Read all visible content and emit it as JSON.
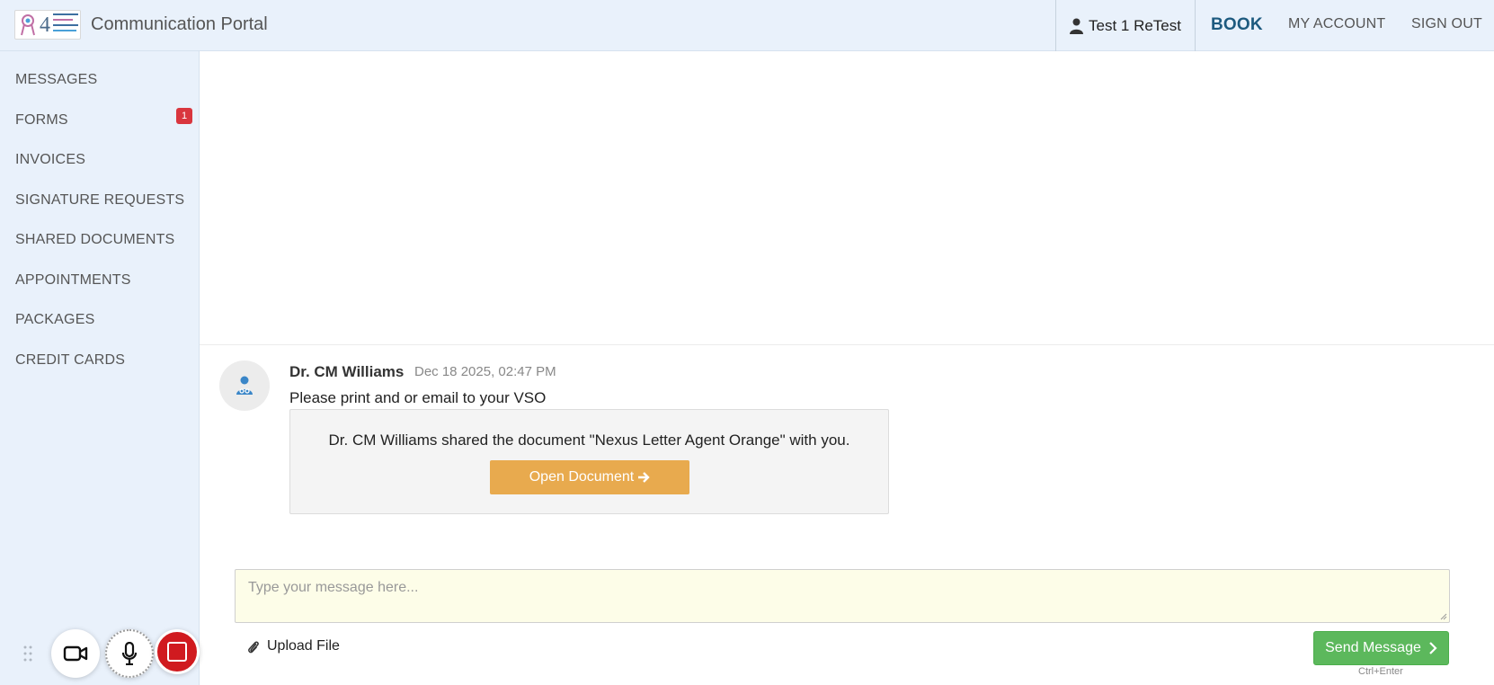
{
  "header": {
    "logo_alt": "Questions 4 Cancer Doctors",
    "logo_number": "4",
    "title": "Communication Portal",
    "user_name": "Test 1 ReTest",
    "nav": {
      "book": "BOOK",
      "my_account": "MY ACCOUNT",
      "sign_out": "SIGN OUT"
    }
  },
  "sidebar": {
    "items": [
      {
        "label": "MESSAGES"
      },
      {
        "label": "FORMS",
        "badge": "1"
      },
      {
        "label": "INVOICES"
      },
      {
        "label": "SIGNATURE REQUESTS"
      },
      {
        "label": "SHARED DOCUMENTS"
      },
      {
        "label": "APPOINTMENTS"
      },
      {
        "label": "PACKAGES"
      },
      {
        "label": "CREDIT CARDS"
      }
    ]
  },
  "message": {
    "sender": "Dr. CM Williams",
    "timestamp": "Dec 18 2025, 02:47 PM",
    "text": "Please print and or email to your VSO",
    "shared_doc": {
      "text": "Dr. CM Williams shared the document \"Nexus Letter Agent Orange\" with you.",
      "button_label": "Open Document"
    }
  },
  "composer": {
    "placeholder": "Type your message here...",
    "upload_label": "Upload File",
    "send_label": "Send Message",
    "send_hint": "Ctrl+Enter"
  },
  "colors": {
    "header_bg": "#e9f1fb",
    "book_link": "#1d5a7f",
    "badge": "#d9363e",
    "open_button": "#e8aa4e",
    "send_button": "#5cb85c",
    "input_bg": "#fdfde8",
    "stop_button": "#d01a1f"
  },
  "icons": {
    "user": "user-icon",
    "doctor": "doctor-icon",
    "open_arrow": "arrow-right-icon",
    "upload": "paperclip-icon",
    "send": "chevron-right-icon",
    "video": "video-camera-icon",
    "mic": "microphone-icon",
    "stop": "stop-icon",
    "grip": "drag-handle-icon"
  }
}
